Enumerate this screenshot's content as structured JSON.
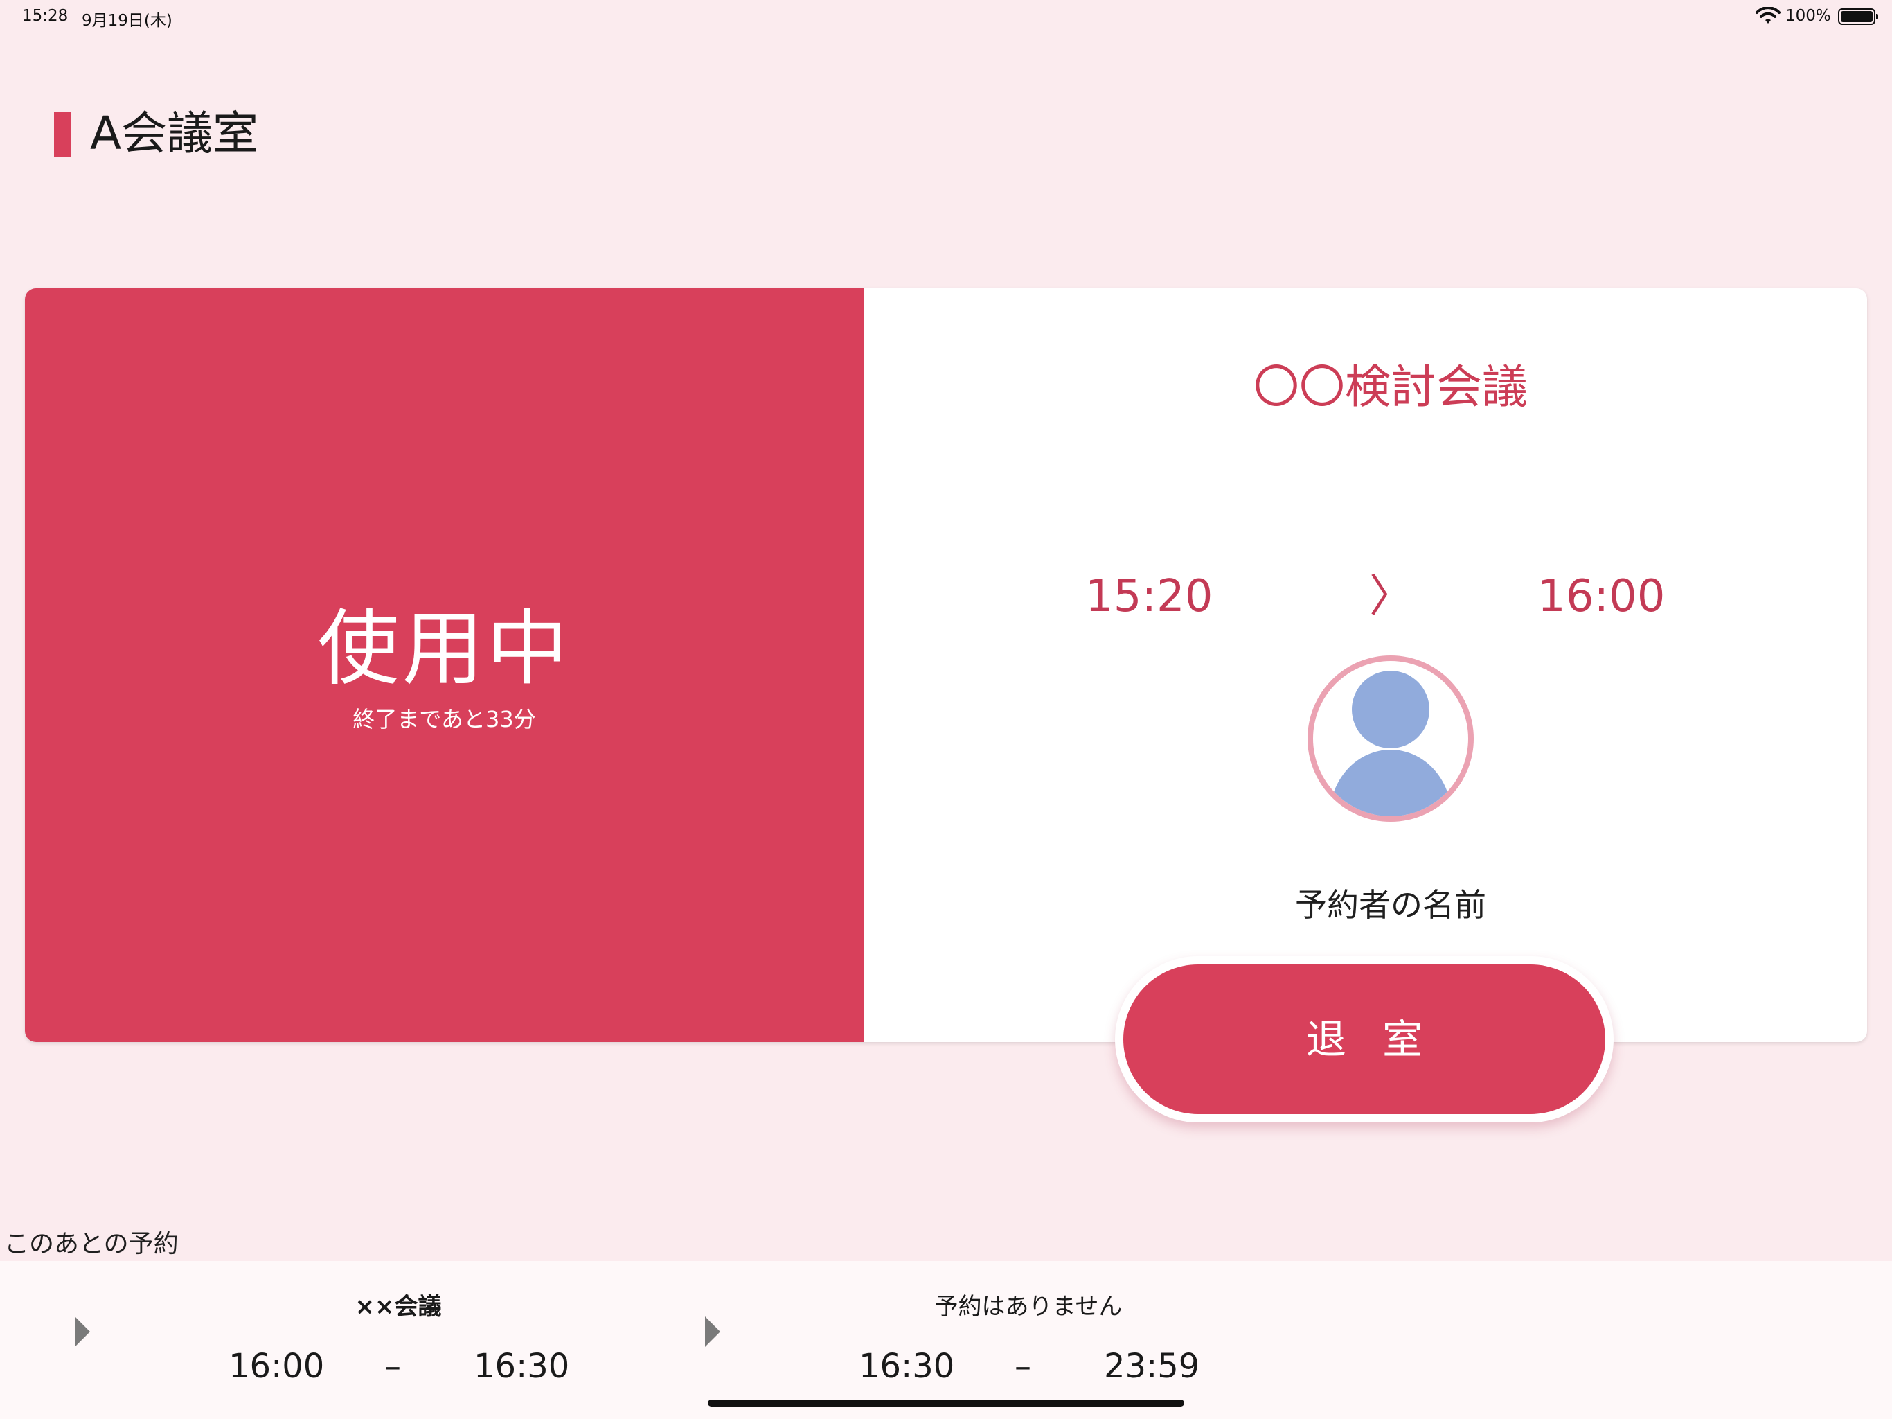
{
  "status_bar": {
    "time": "15:28",
    "date": "9月19日(木)",
    "battery": "100%"
  },
  "room": {
    "title": "A会議室"
  },
  "status": {
    "label": "使用中",
    "remaining": "終了まであと33分"
  },
  "meeting": {
    "title": "〇〇検討会議",
    "start": "15:20",
    "arrow": "〉",
    "end": "16:00",
    "booker": "予約者の名前"
  },
  "checkout": {
    "label": "退室"
  },
  "upcoming": {
    "label": "このあとの予約",
    "items": [
      {
        "title": "××会議",
        "start": "16:00",
        "dash": "–",
        "end": "16:30"
      },
      {
        "title": "予約はありません",
        "start": "16:30",
        "dash": "–",
        "end": "23:59"
      }
    ]
  },
  "colors": {
    "accent": "#d8405b",
    "background": "#fbebee",
    "avatar_ring": "#eba2b2",
    "avatar_fill": "#91abdc"
  }
}
